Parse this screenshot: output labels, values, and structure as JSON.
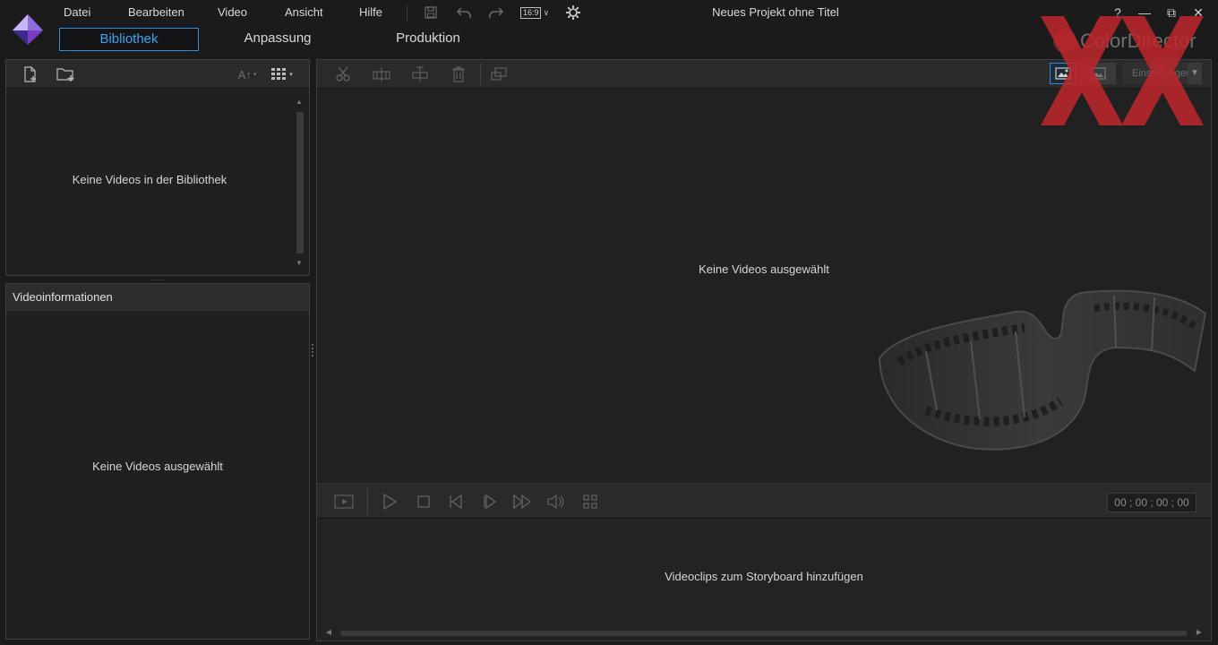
{
  "menu": {
    "items": [
      "Datei",
      "Bearbeiten",
      "Video",
      "Ansicht",
      "Hilfe"
    ],
    "aspect_ratio": "16:9"
  },
  "window": {
    "title": "Neues Projekt ohne Titel",
    "help": "?",
    "minimize": "—",
    "restore": "⧉",
    "close": "✕"
  },
  "tabs": {
    "library": "Bibliothek",
    "edit": "Anpassung",
    "produce": "Produktion"
  },
  "brand": {
    "name": "ColorDirector"
  },
  "library": {
    "empty_text": "Keine Videos in der Bibliothek",
    "sort_label": "A↑",
    "splitter": "....."
  },
  "video_info": {
    "header": "Videoinformationen",
    "empty_text": "Keine Videos ausgewählt"
  },
  "main_toolbar": {
    "settings_label": "Einstellungen"
  },
  "preview": {
    "empty_text": "Keine Videos ausgewählt"
  },
  "playback": {
    "timecode": "00 ; 00 ; 00 ; 00"
  },
  "storyboard": {
    "empty_text": "Videoclips zum Storyboard hinzufügen"
  },
  "colors": {
    "accent": "#2f8dd8",
    "background": "#1b1b1c",
    "panel": "#202021",
    "watermark": "#c0262c"
  }
}
